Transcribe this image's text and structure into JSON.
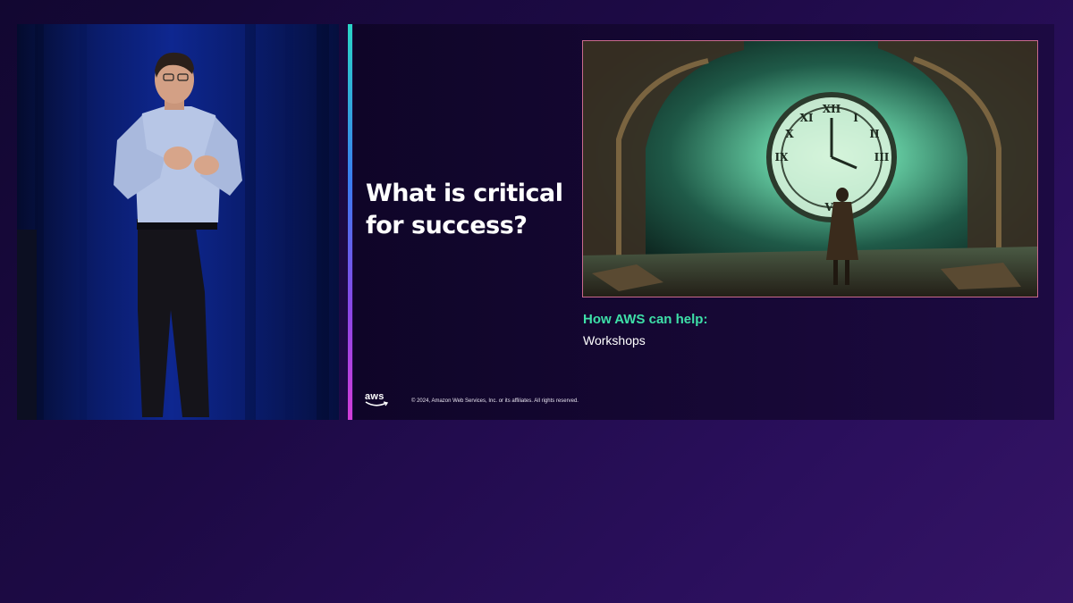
{
  "slide": {
    "title": "What is critical for success?",
    "help_heading": "How AWS can help:",
    "help_items": [
      "Workshops"
    ],
    "logo_text": "aws",
    "copyright": "© 2024, Amazon Web Services, Inc. or its affiliates. All rights reserved.",
    "image_icon": "clock-tower-illustration",
    "colors": {
      "help_heading": "#3ee0a8",
      "divider_top": "#2ad5c6",
      "divider_bottom": "#d43dd8",
      "background": "#1d0a45"
    }
  },
  "speaker": {
    "icon": "presenter-photo"
  }
}
